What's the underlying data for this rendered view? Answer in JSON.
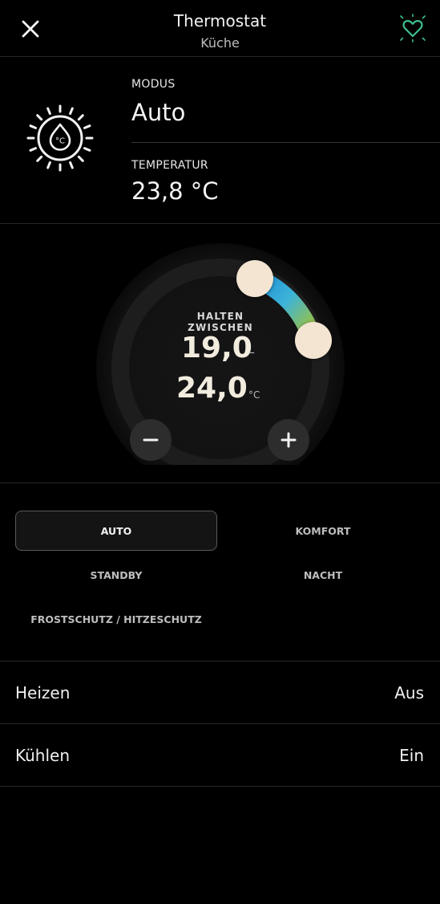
{
  "header": {
    "title": "Thermostat",
    "subtitle": "Küche",
    "close_icon": "close-icon",
    "favorite_icon": "heart-icon"
  },
  "info": {
    "icon": "thermostat-dial-icon",
    "icon_text": "°C",
    "mode_label": "MODUS",
    "mode_value": "Auto",
    "temp_label": "TEMPERATUR",
    "temp_value": "23,8 °C"
  },
  "dial": {
    "hold_label": "HALTEN ZWISCHEN",
    "low": "19,0",
    "dash": "–",
    "high": "24,0",
    "unit": "°C",
    "minus_icon": "minus-icon",
    "plus_icon": "plus-icon",
    "gradient_colors": [
      "#1e8fd6",
      "#3db4d8",
      "#8cbf5a",
      "#a69a3a"
    ]
  },
  "modes": [
    {
      "label": "AUTO",
      "active": true
    },
    {
      "label": "KOMFORT",
      "active": false
    },
    {
      "label": "STANDBY",
      "active": false
    },
    {
      "label": "NACHT",
      "active": false
    },
    {
      "label": "FROSTSCHUTZ / HITZESCHUTZ",
      "active": false
    }
  ],
  "rows": [
    {
      "label": "Heizen",
      "value": "Aus"
    },
    {
      "label": "Kühlen",
      "value": "Ein"
    }
  ],
  "colors": {
    "background": "#000000",
    "accent_green": "#3fbf8f",
    "knob": "#f3e5d2"
  }
}
